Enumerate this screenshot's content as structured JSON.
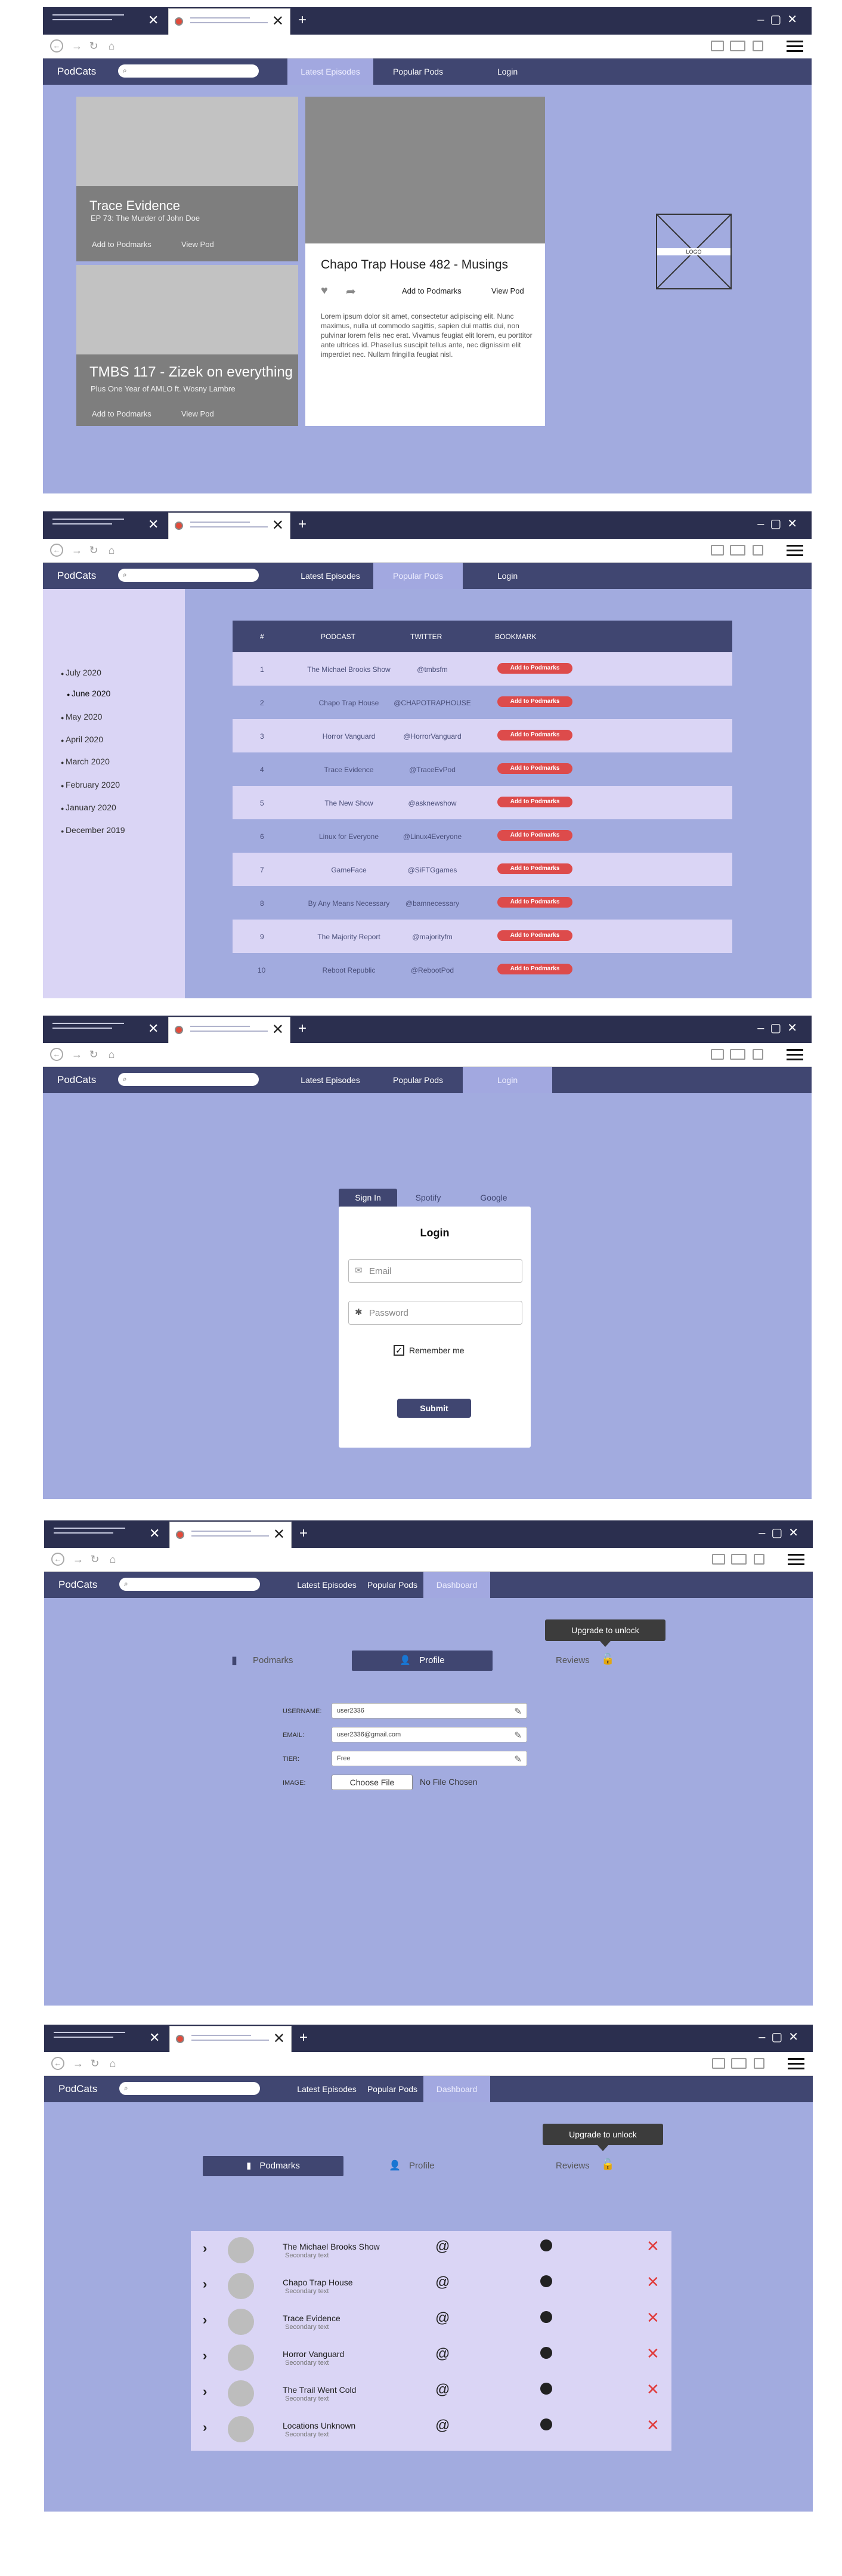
{
  "brand": "PodCats",
  "nav": {
    "latest": "Latest Episodes",
    "popular": "Popular Pods",
    "login": "Login",
    "dashboard": "Dashboard"
  },
  "frame1": {
    "cards": [
      {
        "title": "Trace Evidence",
        "subtitle": "EP 73: The Murder of John Doe",
        "add": "Add to Podmarks",
        "view": "View Pod"
      },
      {
        "title": "TMBS 117 - Zizek on everything",
        "subtitle": "Plus One Year of AMLO ft. Wosny Lambre",
        "add": "Add to Podmarks",
        "view": "View Pod"
      }
    ],
    "featured": {
      "title": "Chapo Trap House 482 - Musings",
      "add": "Add to Podmarks",
      "view": "View Pod",
      "body": "Lorem ipsum dolor sit amet, consectetur adipiscing elit. Nunc maximus, nulla ut commodo sagittis, sapien dui mattis dui, non pulvinar lorem felis nec erat. Vivamus feugiat elit lorem, eu porttitor ante ultrices id. Phasellus suscipit tellus ante, nec dignissim elit imperdiet nec. Nullam fringilla feugiat nisl."
    },
    "logo": "LOGO"
  },
  "frame2": {
    "months": [
      "July 2020",
      "June 2020",
      "May 2020",
      "April 2020",
      "March 2020",
      "February 2020",
      "January 2020",
      "December 2019"
    ],
    "headers": [
      "#",
      "PODCAST",
      "TWITTER",
      "BOOKMARK"
    ],
    "button": "Add to Podmarks",
    "rows": [
      {
        "n": "1",
        "pod": "The Michael Brooks Show",
        "tw": "@tmbsfm"
      },
      {
        "n": "2",
        "pod": "Chapo Trap House",
        "tw": "@CHAPOTRAPHOUSE"
      },
      {
        "n": "3",
        "pod": "Horror Vanguard",
        "tw": "@HorrorVanguard"
      },
      {
        "n": "4",
        "pod": "Trace Evidence",
        "tw": "@TraceEvPod"
      },
      {
        "n": "5",
        "pod": "The New Show",
        "tw": "@asknewshow"
      },
      {
        "n": "6",
        "pod": "Linux for Everyone",
        "tw": "@Linux4Everyone"
      },
      {
        "n": "7",
        "pod": "GameFace",
        "tw": "@SiFTGgames"
      },
      {
        "n": "8",
        "pod": "By Any Means Necessary",
        "tw": "@bamnecessary"
      },
      {
        "n": "9",
        "pod": "The Majority Report",
        "tw": "@majorityfm"
      },
      {
        "n": "10",
        "pod": "Reboot Republic",
        "tw": "@RebootPod"
      }
    ]
  },
  "frame3": {
    "tabs": [
      "Sign In",
      "Spotify",
      "Google"
    ],
    "heading": "Login",
    "email_placeholder": "Email",
    "password_placeholder": "Password",
    "remember": "Remember me",
    "submit": "Submit"
  },
  "dash": {
    "podmarks": "Podmarks",
    "profile": "Profile",
    "reviews": "Reviews",
    "tooltip": "Upgrade to unlock"
  },
  "frame4": {
    "labels": [
      "USERNAME:",
      "EMAIL:",
      "TIER:",
      "IMAGE:"
    ],
    "username": "user2336",
    "email": "user2336@gmail.com",
    "tier": "Free",
    "choose": "Choose File",
    "nofile": "No File Chosen"
  },
  "frame5": {
    "secondary": "Secondary text",
    "items": [
      "The Michael Brooks Show",
      "Chapo Trap House",
      "Trace Evidence",
      "Horror Vanguard",
      "The Trail Went Cold",
      "Locations Unknown"
    ]
  }
}
